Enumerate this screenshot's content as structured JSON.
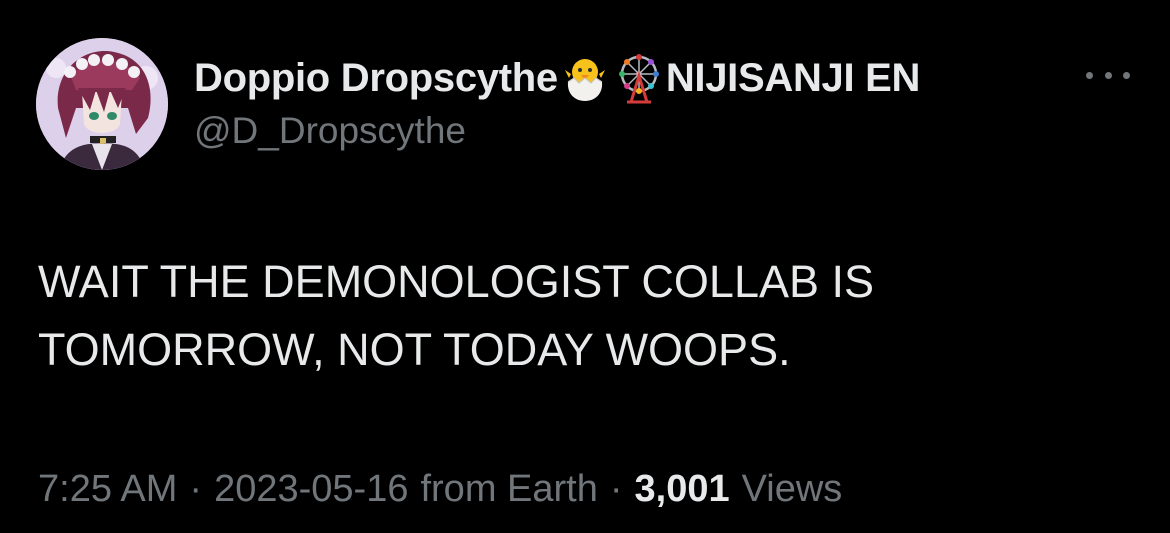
{
  "tweet": {
    "display_name": "Doppio Dropscythe",
    "org_name": "NIJISANJI EN",
    "emoji_1": "hatching-chick-icon",
    "emoji_2": "ferris-wheel-icon",
    "handle": "@D_Dropscythe",
    "text_line_1": "WAIT THE DEMONOLOGIST COLLAB IS",
    "text_line_2": "TOMORROW, NOT TODAY WOOPS.",
    "time": "7:25 AM",
    "date": "2023-05-16",
    "source": "from Earth",
    "separator": "·",
    "views_count": "3,001",
    "views_label": "Views"
  },
  "colors": {
    "background": "#000000",
    "primary_text": "#e7e9ea",
    "secondary_text": "#71767b"
  }
}
